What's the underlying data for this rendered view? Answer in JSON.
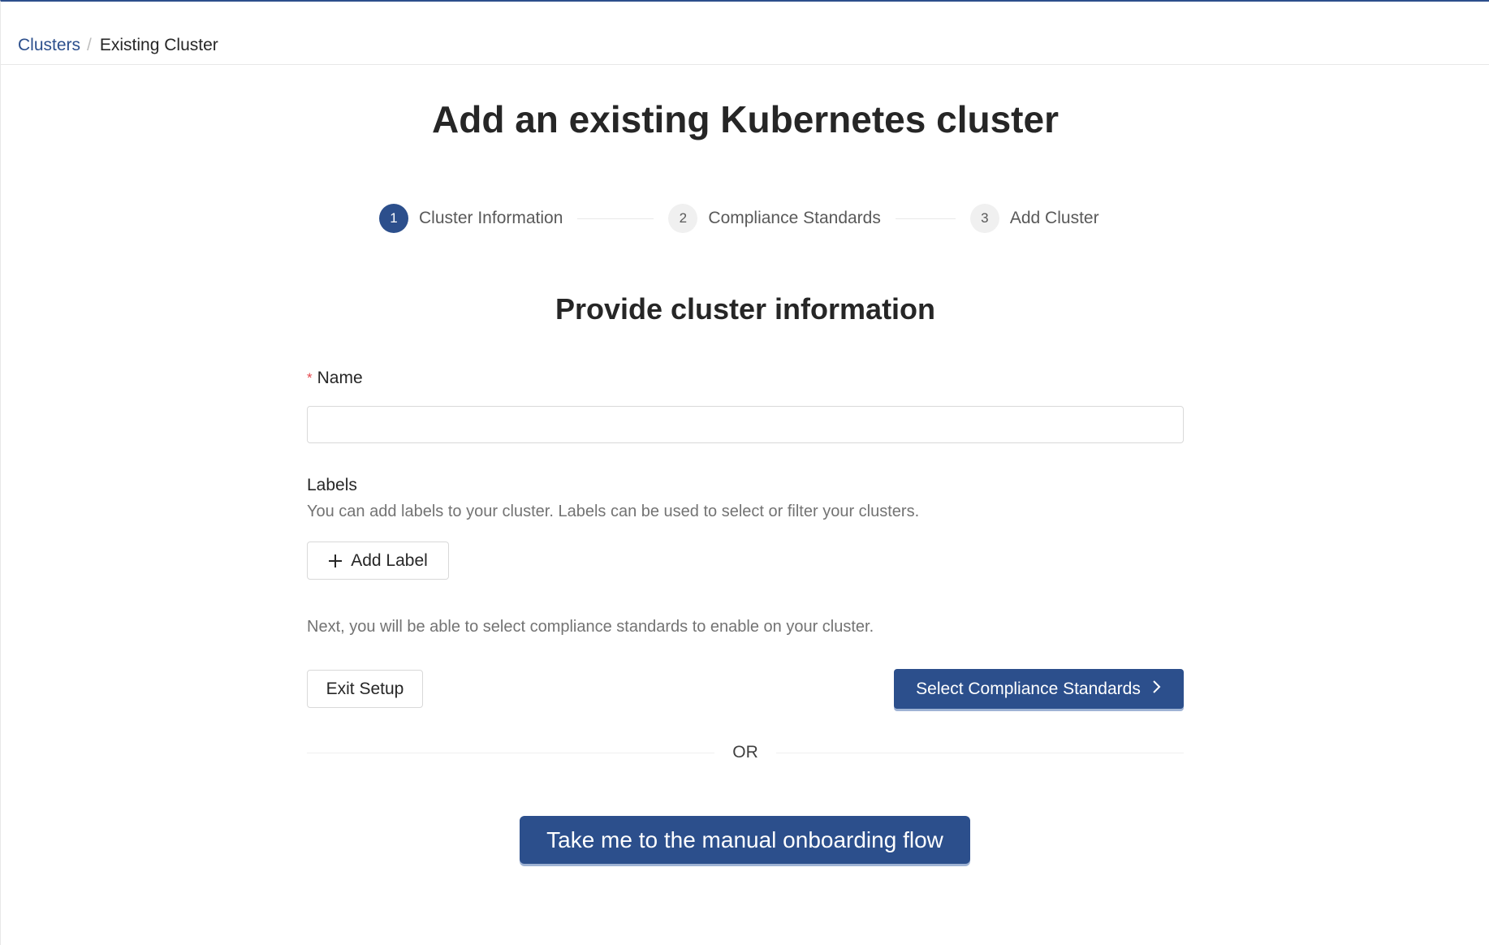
{
  "breadcrumb": {
    "parent": "Clusters",
    "separator": "/",
    "current": "Existing Cluster"
  },
  "page_title": "Add an existing Kubernetes cluster",
  "steps": [
    {
      "number": "1",
      "label": "Cluster Information",
      "state": "active"
    },
    {
      "number": "2",
      "label": "Compliance Standards",
      "state": "pending"
    },
    {
      "number": "3",
      "label": "Add Cluster",
      "state": "pending"
    }
  ],
  "section_title": "Provide cluster information",
  "form": {
    "name_required_mark": "*",
    "name_label": "Name",
    "name_value": "",
    "labels_label": "Labels",
    "labels_help": "You can add labels to your cluster. Labels can be used to select or filter your clusters.",
    "add_label_button": "Add Label",
    "next_text": "Next, you will be able to select compliance standards to enable on your cluster.",
    "exit_button": "Exit Setup",
    "select_button": "Select Compliance Standards",
    "divider_text": "OR",
    "manual_button": "Take me to the manual onboarding flow"
  },
  "colors": {
    "accent": "#2c4f8c",
    "required": "#e5484d"
  },
  "icons": {
    "add": "plus-icon",
    "next": "chevron-right-icon"
  }
}
